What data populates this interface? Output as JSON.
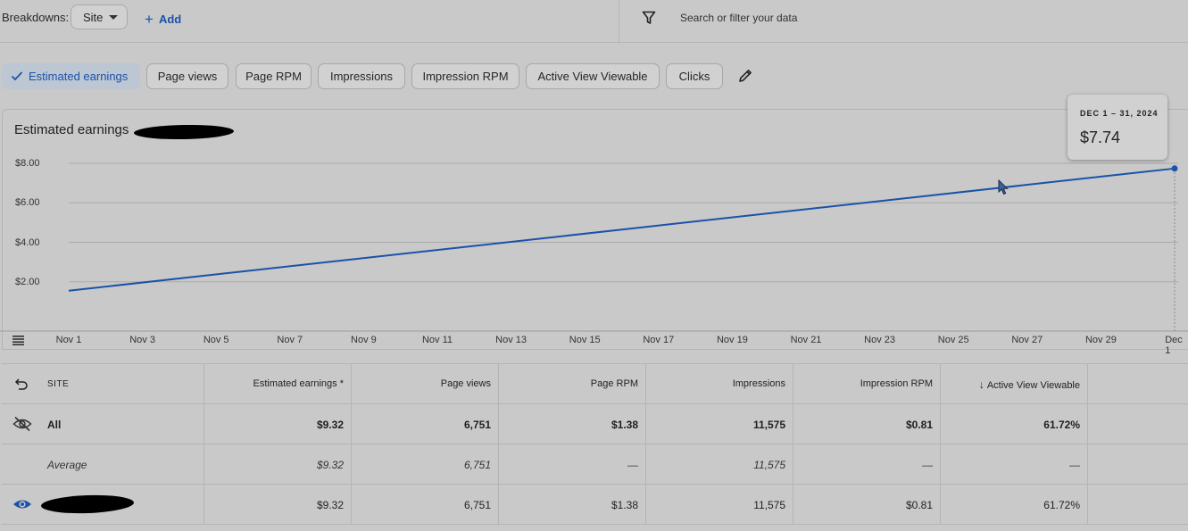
{
  "toolbar": {
    "breakdowns_label": "Breakdowns:",
    "site_select_value": "Site",
    "add_label": "Add",
    "search_placeholder": "Search or filter your data"
  },
  "metric_chips": [
    {
      "label": "Estimated earnings",
      "active": true
    },
    {
      "label": "Page views",
      "active": false
    },
    {
      "label": "Page RPM",
      "active": false
    },
    {
      "label": "Impressions",
      "active": false
    },
    {
      "label": "Impression RPM",
      "active": false
    },
    {
      "label": "Active View Viewable",
      "active": false
    },
    {
      "label": "Clicks",
      "active": false
    }
  ],
  "chart_card": {
    "title": "Estimated earnings",
    "series_color": "#1a52a8"
  },
  "tooltip": {
    "date": "DEC 1 – 31, 2024",
    "value": "$7.74"
  },
  "chart_data": {
    "type": "line",
    "x": [
      "Nov 1",
      "Dec 1"
    ],
    "series": [
      {
        "values": [
          1.55,
          7.74
        ]
      }
    ],
    "x_tick_labels": [
      "Nov 1",
      "Nov 3",
      "Nov 5",
      "Nov 7",
      "Nov 9",
      "Nov 11",
      "Nov 13",
      "Nov 15",
      "Nov 17",
      "Nov 19",
      "Nov 21",
      "Nov 23",
      "Nov 25",
      "Nov 27",
      "Nov 29",
      "Dec 1"
    ],
    "y_tick_labels": [
      "$8.00",
      "$6.00",
      "$4.00",
      "$2.00"
    ],
    "y_ticks": [
      8,
      6,
      4,
      2
    ],
    "ylim": [
      0,
      8.5
    ],
    "grid": true
  },
  "table": {
    "headers": [
      "SITE",
      "Estimated earnings *",
      "Page views",
      "Page RPM",
      "Impressions",
      "Impression RPM",
      "Active View Viewable"
    ],
    "sort_column": "Active View Viewable",
    "rows": [
      {
        "label": "All",
        "values": [
          "$9.32",
          "6,751",
          "$1.38",
          "11,575",
          "$0.81",
          "61.72%"
        ]
      },
      {
        "label": "Average",
        "values": [
          "$9.32",
          "6,751",
          "—",
          "11,575",
          "—",
          "—"
        ]
      },
      {
        "label": "",
        "values": [
          "$9.32",
          "6,751",
          "$1.38",
          "11,575",
          "$0.81",
          "61.72%"
        ]
      }
    ]
  },
  "icons": {
    "filter": "filter-icon",
    "edit": "pencil-icon",
    "undo": "undo-icon",
    "hidden": "eye-off-icon",
    "visible": "eye-icon",
    "menu": "menu-icon"
  }
}
